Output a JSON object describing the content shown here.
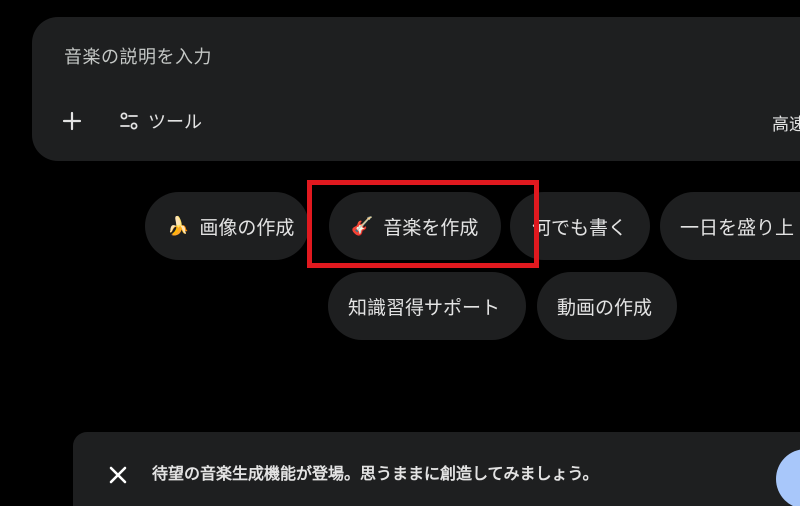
{
  "prompt": {
    "placeholder": "音楽の説明を入力",
    "tools_label": "ツール",
    "model_label": "高速"
  },
  "chips": [
    {
      "label": "画像の作成",
      "icon": "banana-icon",
      "emoji": "🍌"
    },
    {
      "label": "音楽を作成",
      "icon": "guitar-icon",
      "emoji": "🎸"
    },
    {
      "label": "何でも書く"
    },
    {
      "label": "一日を盛り上"
    },
    {
      "label": "知識習得サポート"
    },
    {
      "label": "動画の作成"
    }
  ],
  "banner": {
    "text": "待望の音楽生成機能が登場。思うままに創造してみましょう。"
  },
  "colors": {
    "background": "#000000",
    "surface": "#1e1f20",
    "text": "#e3e3e3",
    "highlight": "#e0191f",
    "accent": "#a8c7fa"
  }
}
